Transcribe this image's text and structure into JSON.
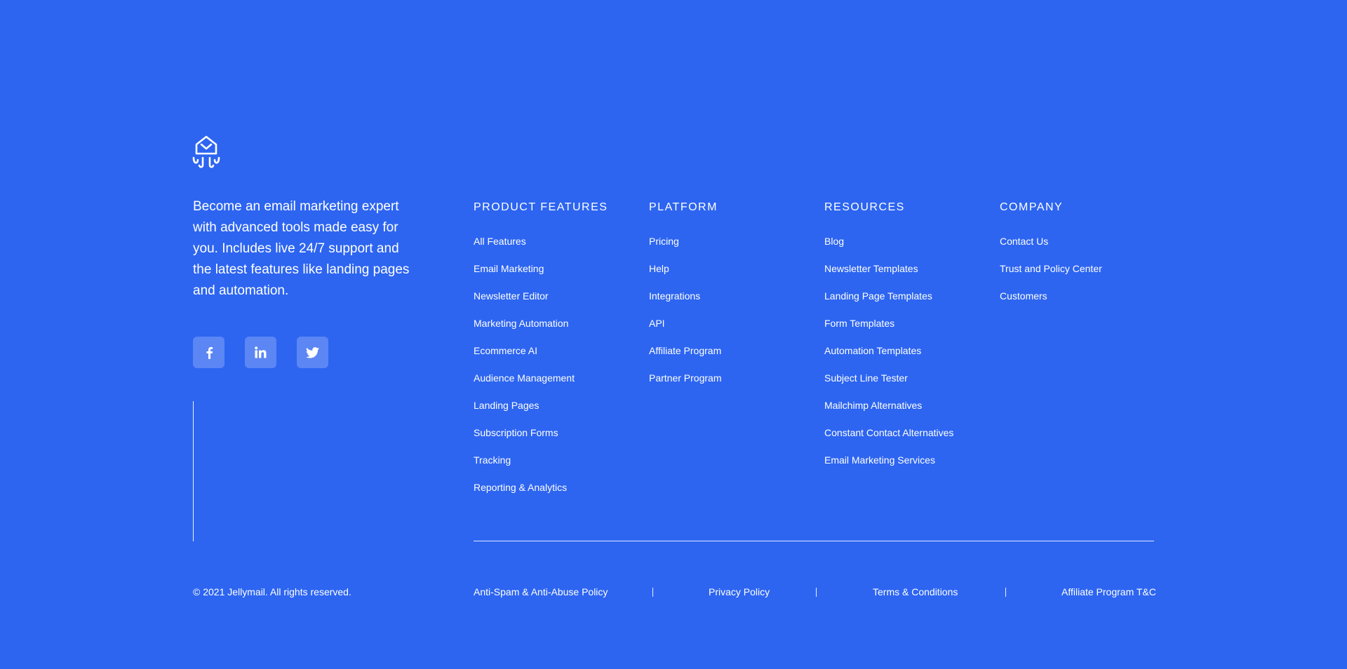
{
  "brand": {
    "logo_icon": "jellyfish-envelope-logo-icon",
    "tagline": "Become an email marketing expert with advanced tools made easy for you. Includes live 24/7 support and the latest features like landing pages and automation."
  },
  "social": [
    {
      "name": "facebook",
      "icon": "facebook-icon"
    },
    {
      "name": "linkedin",
      "icon": "linkedin-icon"
    },
    {
      "name": "twitter",
      "icon": "twitter-icon"
    }
  ],
  "columns": {
    "product_features": {
      "title": "PRODUCT FEATURES",
      "links": [
        "All Features",
        "Email Marketing",
        "Newsletter Editor",
        "Marketing Automation",
        "Ecommerce AI",
        "Audience Management",
        "Landing Pages",
        "Subscription Forms",
        "Tracking",
        "Reporting & Analytics"
      ]
    },
    "platform": {
      "title": "PLATFORM",
      "links": [
        "Pricing",
        "Help",
        "Integrations",
        "API",
        "Affiliate Program",
        "Partner Program"
      ]
    },
    "resources": {
      "title": "RESOURCES",
      "links": [
        "Blog",
        "Newsletter Templates",
        "Landing Page Templates",
        "Form Templates",
        "Automation Templates",
        "Subject Line Tester",
        "Mailchimp Alternatives",
        "Constant Contact Alternatives",
        "Email Marketing Services"
      ]
    },
    "company": {
      "title": "COMPANY",
      "links": [
        "Contact Us",
        "Trust and Policy Center",
        "Customers"
      ]
    }
  },
  "bottom": {
    "copyright": "© 2021 Jellymail. All rights reserved.",
    "legal_links": [
      "Anti-Spam & Anti-Abuse Policy",
      "Privacy Policy",
      "Terms & Conditions",
      "Affiliate Program T&C"
    ]
  },
  "colors": {
    "background": "#2d65f1",
    "text": "#ffffff"
  }
}
